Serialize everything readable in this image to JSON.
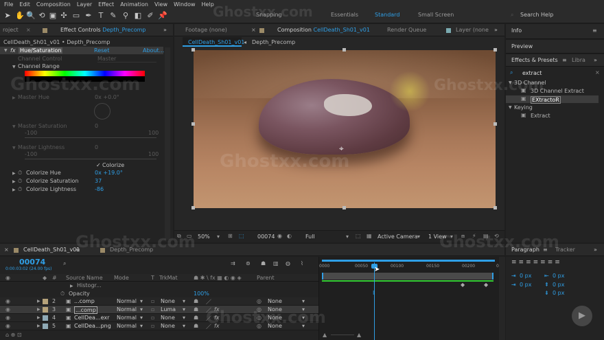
{
  "menu": [
    "File",
    "Edit",
    "Composition",
    "Layer",
    "Effect",
    "Animation",
    "View",
    "Window",
    "Help"
  ],
  "workspaces": {
    "snapping": "Snapping",
    "essentials": "Essentials",
    "standard": "Standard",
    "small_screen": "Small Screen",
    "search_help": "Search Help"
  },
  "watermark": "Ghostxx.com",
  "effect_controls": {
    "project_tab": "roject",
    "tab": "Effect Controls",
    "tab_comp": "Depth_Precomp",
    "breadcrumb": "CellDeath_Sh01_v01 • Depth_Precomp",
    "fx_label": "fx",
    "effect_name": "Hue/Saturation",
    "reset": "Reset",
    "about": "About...",
    "channel_control_label": "Channel Control",
    "channel_control_value": "Master",
    "channel_range": "Channel Range",
    "master_hue": "Master Hue",
    "master_hue_value": "0x +0.0°",
    "master_saturation": "Master Saturation",
    "master_saturation_value": "0",
    "master_lightness": "Master Lightness",
    "master_lightness_value": "0",
    "range_min": "-100",
    "range_max": "100",
    "colorize": "Colorize",
    "colorize_hue": "Colorize Hue",
    "colorize_hue_value": "0x +19.0°",
    "colorize_saturation": "Colorize Saturation",
    "colorize_saturation_value": "37",
    "colorize_lightness": "Colorize Lightness",
    "colorize_lightness_value": "-86"
  },
  "composition": {
    "footage_tab": "Footage (none)",
    "comp_tab": "Composition",
    "comp_tab_name": "CellDeath_Sh01_v01",
    "render_queue": "Render Queue",
    "layer_tab": "Layer (none",
    "subtab1": "CellDeath_Sh01_v01",
    "subtab2": "Depth_Precomp",
    "zoom": "50%",
    "frame": "00074",
    "resolution": "Full",
    "camera": "Active Camera",
    "view": "1 View"
  },
  "right": {
    "info": "Info",
    "preview": "Preview",
    "effects_presets": "Effects & Presets",
    "libraries": "Libra",
    "search": "extract",
    "tree": [
      {
        "label": "3D Channel",
        "indent": 0
      },
      {
        "label": "3D Channel Extract",
        "indent": 1
      },
      {
        "label": "EXtractoR",
        "indent": 1,
        "selected": true
      },
      {
        "label": "Keying",
        "indent": 0
      },
      {
        "label": "Extract",
        "indent": 1
      }
    ],
    "paragraph": "Paragraph",
    "tracker": "Tracker",
    "para_values": [
      "0 px",
      "0 px",
      "0 px",
      "0 px",
      "0 px"
    ]
  },
  "timeline": {
    "tab1": "CellDeath_Sh01_v01",
    "tab2": "Depth_Precomp",
    "timecode": "00074",
    "timecode_sub": "0:00:03:02 (24.00 fps)",
    "columns": {
      "source_name": "Source Name",
      "mode": "Mode",
      "t": "T",
      "trkmat": "TrkMat",
      "parent": "Parent"
    },
    "ruler": [
      "0000",
      "00050",
      "00100",
      "00150",
      "00200",
      "0"
    ],
    "histogram_row": "Histogr...",
    "opacity_label": "Opacity",
    "opacity_value": "100%",
    "layers": [
      {
        "num": "2",
        "name": "...comp",
        "mode": "Normal",
        "trkmat": "None",
        "parent": "None",
        "color": "#b5a27a",
        "selected": false,
        "fx": false
      },
      {
        "num": "3",
        "name": "...comp",
        "mode": "Normal",
        "trkmat": "Luma",
        "parent": "None",
        "color": "#b5a27a",
        "selected": true,
        "fx": true
      },
      {
        "num": "4",
        "name": "CellDea...exr",
        "mode": "Normal",
        "trkmat": "None",
        "parent": "None",
        "color": "#8fa9b5",
        "selected": false,
        "fx": true
      },
      {
        "num": "5",
        "name": "CellDea...png",
        "mode": "Normal",
        "trkmat": "None",
        "parent": "None",
        "color": "#8fa9b5",
        "selected": false,
        "fx": true
      }
    ]
  }
}
